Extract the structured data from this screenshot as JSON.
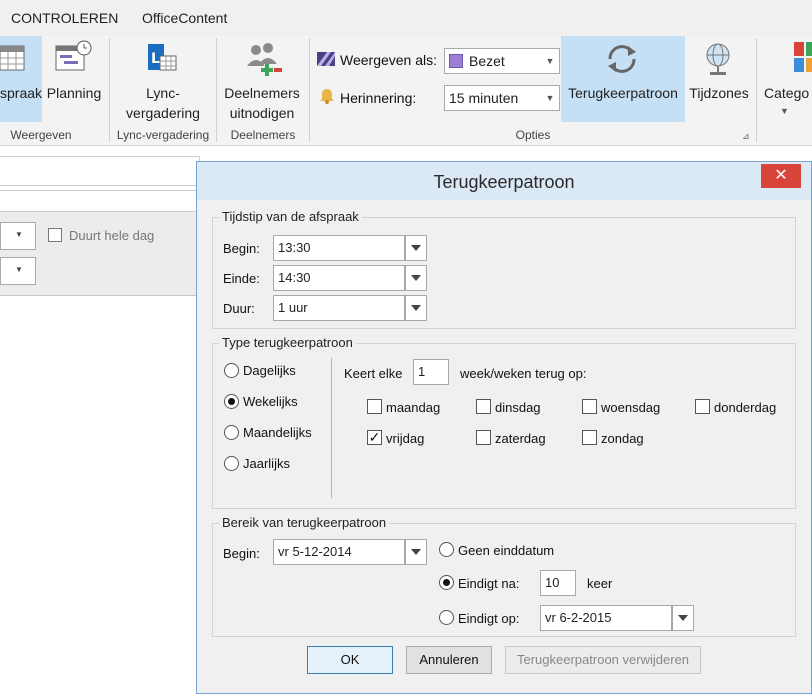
{
  "tabs": [
    "CONTROLEREN",
    "OfficeContent"
  ],
  "ribbon": {
    "afspraak_label": "spraak",
    "planning_label": "Planning",
    "lync_label_1": "Lync-",
    "lync_label_2": "vergadering",
    "deelnemers_label_1": "Deelnemers",
    "deelnemers_label_2": "uitnodigen",
    "weergeven_als_label": "Weergeven als:",
    "weergeven_als_value": "Bezet",
    "herinnering_label": "Herinnering:",
    "herinnering_value": "15 minuten",
    "terugkeerpatroon_label": "Terugkeerpatroon",
    "tijdzones_label": "Tijdzones",
    "categorie_label": "Catego",
    "groups": {
      "weergeven": "Weergeven",
      "lync": "Lync-vergadering",
      "deelnemers": "Deelnemers",
      "opties": "Opties"
    },
    "busy_color": "#9b80d6",
    "highlight_color": "#c5e0f5"
  },
  "background": {
    "duurt_hele_dag_label": "Duurt hele dag"
  },
  "dialog": {
    "title": "Terugkeerpatroon",
    "close_glyph": "✕",
    "tijdstip": {
      "legend": "Tijdstip van de afspraak",
      "begin_label": "Begin:",
      "begin_value": "13:30",
      "einde_label": "Einde:",
      "einde_value": "14:30",
      "duur_label": "Duur:",
      "duur_value": "1 uur"
    },
    "type": {
      "legend": "Type terugkeerpatroon",
      "options": [
        "Dagelijks",
        "Wekelijks",
        "Maandelijks",
        "Jaarlijks"
      ],
      "selected": "Wekelijks",
      "keert_elke_label": "Keert elke",
      "keert_elke_value": "1",
      "week_suffix": "week/weken terug op:",
      "days": [
        {
          "label": "maandag",
          "checked": false
        },
        {
          "label": "dinsdag",
          "checked": false
        },
        {
          "label": "woensdag",
          "checked": false
        },
        {
          "label": "donderdag",
          "checked": false
        },
        {
          "label": "vrijdag",
          "checked": true
        },
        {
          "label": "zaterdag",
          "checked": false
        },
        {
          "label": "zondag",
          "checked": false
        }
      ]
    },
    "bereik": {
      "legend": "Bereik van terugkeerpatroon",
      "begin_label": "Begin:",
      "begin_value": "vr 5-12-2014",
      "geen_einddatum": "Geen einddatum",
      "eindigt_na_label": "Eindigt na:",
      "eindigt_na_value": "10",
      "keer_label": "keer",
      "eindigt_op_label": "Eindigt op:",
      "eindigt_op_value": "vr 6-2-2015",
      "selected": "Eindigt na"
    },
    "buttons": {
      "ok": "OK",
      "annuleren": "Annuleren",
      "verwijderen": "Terugkeerpatroon verwijderen"
    }
  }
}
